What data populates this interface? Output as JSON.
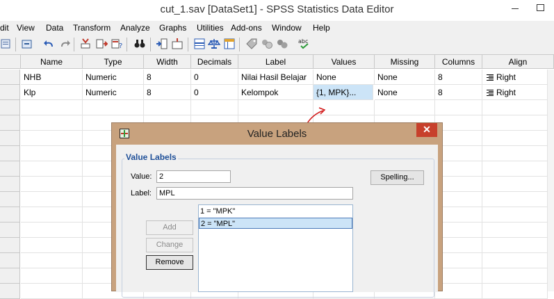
{
  "window": {
    "title": "cut_1.sav [DataSet1] - SPSS Statistics Data Editor"
  },
  "menu": [
    "dit",
    "View",
    "Data",
    "Transform",
    "Analyze",
    "Graphs",
    "Utilities",
    "Add-ons",
    "Window",
    "Help"
  ],
  "grid": {
    "columns": [
      "Name",
      "Type",
      "Width",
      "Decimals",
      "Label",
      "Values",
      "Missing",
      "Columns",
      "Align"
    ],
    "rows": [
      [
        "NHB",
        "Numeric",
        "8",
        "0",
        "Nilai Hasil Belajar",
        "None",
        "None",
        "8",
        "Right"
      ],
      [
        "Klp",
        "Numeric",
        "8",
        "0",
        "Kelompok",
        "{1, MPK}...",
        "None",
        "8",
        "Right"
      ]
    ]
  },
  "dialog": {
    "title": "Value Labels",
    "group_label": "Value Labels",
    "value_label": "Value:",
    "value": "2",
    "label_label": "Label:",
    "label": "MPL",
    "spelling_button": "Spelling...",
    "add_button": "Add",
    "change_button": "Change",
    "remove_button": "Remove",
    "list": [
      "1 = \"MPK\"",
      "2 = \"MPL\""
    ],
    "close_glyph": "✕"
  },
  "colors": {
    "dialog_frame": "#c8a27e",
    "close": "#c7402b",
    "selection": "#cce4f7",
    "group_title": "#1e4f98",
    "annotation": "#d21a1a"
  }
}
